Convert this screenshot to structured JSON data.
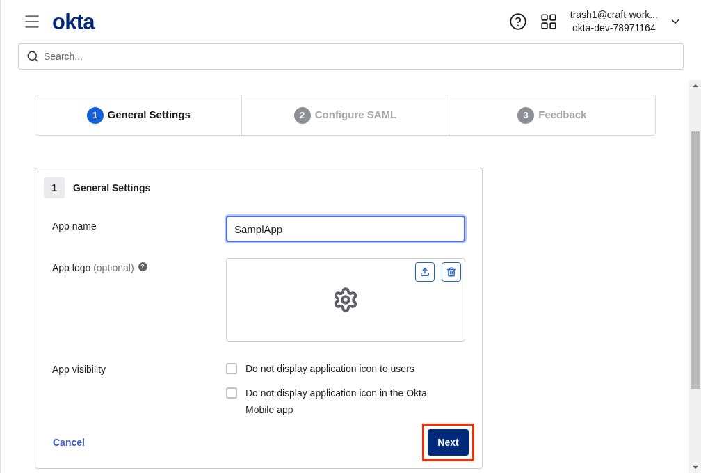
{
  "header": {
    "logo": "okta",
    "user_email": "trash1@craft-work...",
    "org": "okta-dev-78971164"
  },
  "search": {
    "placeholder": "Search..."
  },
  "steps": [
    {
      "number": "1",
      "label": "General Settings",
      "selected": true
    },
    {
      "number": "2",
      "label": "Configure SAML",
      "selected": false
    },
    {
      "number": "3",
      "label": "Feedback",
      "selected": false
    }
  ],
  "panel": {
    "number": "1",
    "title": "General Settings",
    "app_name": {
      "label": "App name",
      "value": "SamplApp"
    },
    "app_logo": {
      "label": "App logo",
      "hint": "(optional)",
      "help": "?"
    },
    "visibility": {
      "label": "App visibility",
      "options": [
        {
          "label": "Do not display application icon to users",
          "checked": false
        },
        {
          "label": "Do not display application icon in the Okta Mobile app",
          "checked": false
        }
      ]
    },
    "cancel": "Cancel",
    "next": {
      "label": "Next",
      "highlighted": true
    }
  }
}
